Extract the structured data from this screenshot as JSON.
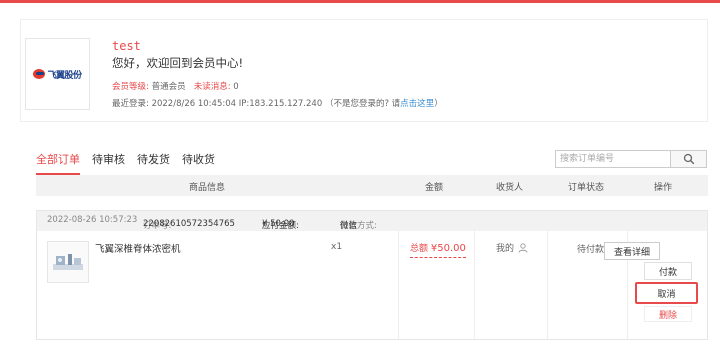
{
  "profile": {
    "logo_text": "飞翼股份",
    "username": "test",
    "welcome": "您好，欢迎回到会员中心!",
    "level_label": "会员等级:",
    "level_value": "普通会员",
    "unread_label": "未读消息:",
    "unread_count": "0",
    "last_login_label": "最近登录:",
    "last_login_value": "2022/8/26 10:45:04 IP:183.215.127.240",
    "not_you_prefix": "（不是您登录的? 请",
    "not_you_link": "点击这里",
    "not_you_suffix": "）"
  },
  "tabs": [
    {
      "label": "全部订单",
      "active": true
    },
    {
      "label": "待审核",
      "active": false
    },
    {
      "label": "待发货",
      "active": false
    },
    {
      "label": "待收货",
      "active": false
    }
  ],
  "search": {
    "placeholder": "搜索订单编号",
    "icon": "search-icon"
  },
  "table_headers": {
    "product": "商品信息",
    "amount": "金额",
    "receiver": "收货人",
    "status": "订单状态",
    "actions": "操作"
  },
  "order": {
    "datetime": "2022-08-26 10:57:23",
    "order_no_label": "订单号:",
    "order_no": "22082610572354765",
    "payable_label": "应付金额:",
    "payable_value": "¥ 50.00",
    "pay_method_label": "付款方式:",
    "pay_method_value": "微信",
    "product_name": "飞翼深椎脊体浓密机",
    "quantity": "x1",
    "total_label": "总额",
    "total_value": "¥50.00",
    "receiver": "我的",
    "receiver_icon": "user-icon",
    "status": "待付款",
    "actions": {
      "detail": "查看详细",
      "pay": "付款",
      "cancel": "取消",
      "delete": "删除"
    }
  },
  "colors": {
    "accent": "#e8494a",
    "link": "#3b8fd3",
    "header_bg": "#f2f2f2"
  }
}
